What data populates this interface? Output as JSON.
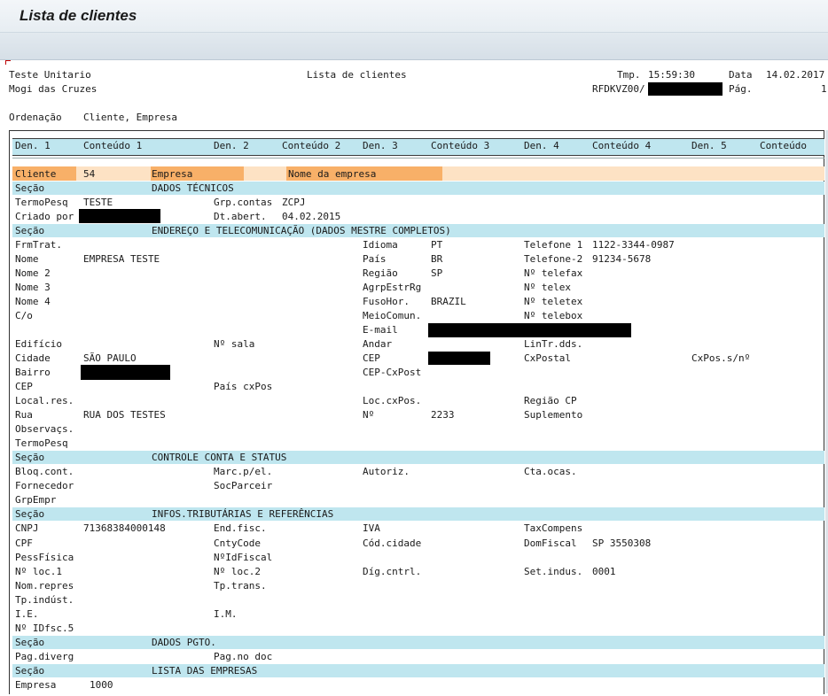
{
  "window": {
    "title": "Lista de clientes"
  },
  "header": {
    "left1": "Teste Unitario",
    "left2": "Mogi das Cruzes",
    "center": "Lista de clientes",
    "tmp_label": "Tmp.",
    "tmp_value": "15:59:30",
    "data_label": "Data",
    "data_value": "14.02.2017",
    "report_id": "RFDKVZ00/",
    "pag_label": "Pág.",
    "pag_value": "1"
  },
  "sort": {
    "label": "Ordenação",
    "value": "Cliente, Empresa"
  },
  "columns": [
    "Den. 1",
    "Conteúdo 1",
    "Den. 2",
    "Conteúdo 2",
    "Den. 3",
    "Conteúdo 3",
    "Den. 4",
    "Conteúdo 4",
    "Den. 5",
    "Conteúdo"
  ],
  "record": {
    "cliente_label": "Cliente",
    "cliente_value": "54",
    "empresa_label": "Empresa",
    "nome_empresa_label": "Nome da empresa"
  },
  "sections": {
    "label": "Seção",
    "dados_tecnicos": "DADOS TÉCNICOS",
    "endereco": "ENDEREÇO E TELECOMUNICAÇÃO (DADOS MESTRE COMPLETOS)",
    "controle": "CONTROLE CONTA E STATUS",
    "infos": "INFOS.TRIBUTÁRIAS E REFERÊNCIAS",
    "pgto": "DADOS PGTO.",
    "empresas": "LISTA DAS EMPRESAS"
  },
  "f": {
    "termopesq": "TermoPesq",
    "termopesq_v": "TESTE",
    "grp_contas": "Grp.contas",
    "grp_contas_v": "ZCPJ",
    "criado_por": "Criado por",
    "dt_abert": "Dt.abert.",
    "dt_abert_v": "04.02.2015",
    "frmtrat": "FrmTrat.",
    "idioma": "Idioma",
    "idioma_v": "PT",
    "telefone1": "Telefone 1",
    "telefone1_v": "1122-3344-0987",
    "nome": "Nome",
    "nome_v": "EMPRESA TESTE",
    "pais": "País",
    "pais_v": "BR",
    "telefone2": "Telefone-2",
    "telefone2_v": "91234-5678",
    "nome2": "Nome 2",
    "regiao": "Região",
    "regiao_v": "SP",
    "telefax": "Nº telefax",
    "nome3": "Nome 3",
    "agrpestrrg": "AgrpEstrRg",
    "telex": "Nº telex",
    "nome4": "Nome 4",
    "fusohor": "FusoHor.",
    "fusohor_v": "BRAZIL",
    "teletex": "Nº teletex",
    "co": "C/o",
    "meiocomun": "MeioComun.",
    "telebox": "Nº telebox",
    "email": "E-mail",
    "edificio": "Edifício",
    "sala": "Nº sala",
    "andar": "Andar",
    "lintr": "LinTr.dds.",
    "cidade": "Cidade",
    "cidade_v": "SÃO PAULO",
    "cep": "CEP",
    "cxpostal": "CxPostal",
    "cxpos": "CxPos.s/nº",
    "bairro": "Bairro",
    "cep_cxpost": "CEP-CxPost",
    "cep2": "CEP",
    "pais_cxpos": "País cxPos",
    "localres": "Local.res.",
    "loc_cxpos": "Loc.cxPos.",
    "regiao_cp": "Região CP",
    "rua": "Rua",
    "rua_v": "RUA DOS TESTES",
    "numero": "Nº",
    "numero_v": "2233",
    "suplemento": "Suplemento",
    "observacs": "Observaçs.",
    "termopesq2": "TermoPesq",
    "bloq_cont": "Bloq.cont.",
    "marc_pel": "Marc.p/el.",
    "autoriz": "Autoriz.",
    "cta_ocas": "Cta.ocas.",
    "fornecedor": "Fornecedor",
    "socparceir": "SocParceir",
    "grpempr": "GrpEmpr",
    "cnpj": "CNPJ",
    "cnpj_v": "71368384000148",
    "end_fisc": "End.fisc.",
    "iva": "IVA",
    "taxcompens": "TaxCompens",
    "cpf": "CPF",
    "cntycode": "CntyCode",
    "cod_cidade": "Cód.cidade",
    "domfiscal": "DomFiscal",
    "domfiscal_v": "SP 3550308",
    "pessfisica": "PessFísica",
    "nidfiscal": "NºIdFiscal",
    "nloc1": "Nº loc.1",
    "nloc2": "Nº loc.2",
    "dig_cntrl": "Díg.cntrl.",
    "set_indus": "Set.indus.",
    "set_indus_v": "0001",
    "nom_repres": "Nom.repres",
    "tp_trans": "Tp.trans.",
    "tp_indust": "Tp.indúst.",
    "ie": "I.E.",
    "im": "I.M.",
    "idfsc5": "Nº IDfsc.5",
    "pag_diverg": "Pag.diverg",
    "pag_no_doc": "Pag.no doc",
    "empresa": "Empresa",
    "empresa_v": "1000"
  }
}
